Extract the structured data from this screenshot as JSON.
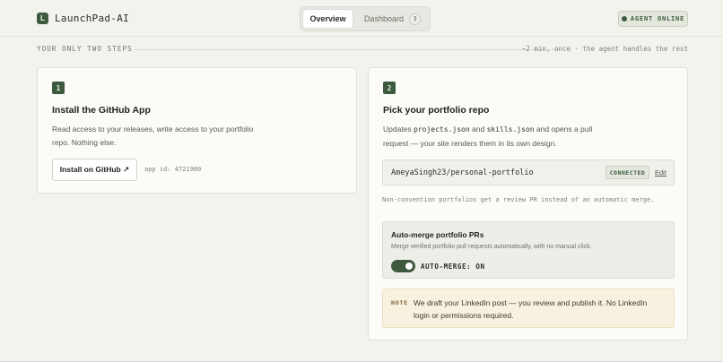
{
  "brand": {
    "mark": "L",
    "name": "LaunchPad-AI"
  },
  "nav": {
    "tabs": [
      {
        "label": "Overview",
        "active": true
      },
      {
        "label": "Dashboard",
        "badge": "3",
        "active": false
      }
    ]
  },
  "status": {
    "text": "AGENT ONLINE"
  },
  "steps": {
    "label": "YOUR ONLY TWO STEPS",
    "note": "~2 min, once · the agent handles the rest"
  },
  "step1": {
    "number": "1",
    "title": "Install the GitHub App",
    "description": "Read access to your releases, write access to your portfolio repo. Nothing else.",
    "button": "Install on GitHub ↗",
    "app_id": "app id: 4721900"
  },
  "step2": {
    "number": "2",
    "title": "Pick your portfolio repo",
    "desc_prefix": "Updates ",
    "desc_file1": "projects.json",
    "desc_and": " and ",
    "desc_file2": "skills.json",
    "desc_suffix": " and opens a pull request — your site renders them in its own design.",
    "repo": "AmeyaSingh23/personal-portfolio",
    "connected": "CONNECTED",
    "edit": "Edit",
    "hint": "Non-convention portfolios get a review PR instead of an automatic merge.",
    "automerge": {
      "title": "Auto-merge portfolio PRs",
      "description": "Merge verified portfolio pull requests automatically, with no manual click.",
      "state": "AUTO-MERGE: ON",
      "enabled": true
    },
    "note": {
      "tag": "NOTE",
      "text": "We draft your LinkedIn post — you review and publish it. No LinkedIn login or permissions required."
    }
  },
  "colors": {
    "accent": "#3d5a3f",
    "background": "#f3f3ee",
    "card": "#fbfbf8",
    "note_bg": "#f9f1df"
  }
}
